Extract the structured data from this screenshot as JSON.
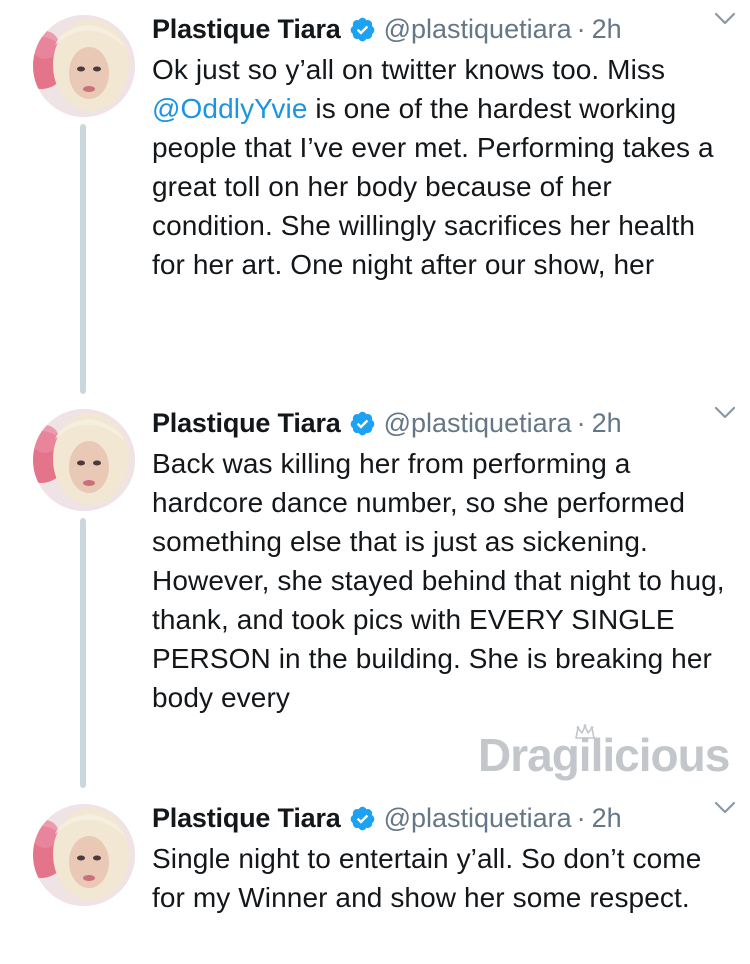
{
  "tweets": [
    {
      "display_name": "Plastique Tiara",
      "handle": "@plastiquetiara",
      "dot": "·",
      "timestamp": "2h",
      "text_before": "Ok just so y’all on twitter knows too. Miss ",
      "mention": "@OddlyYvie",
      "text_after": " is one of the hardest working people that I’ve ever met. Performing takes a great toll on her body because of her condition. She willingly sacrifices her health for her art. One night after our show, her"
    },
    {
      "display_name": "Plastique Tiara",
      "handle": "@plastiquetiara",
      "dot": "·",
      "timestamp": "2h",
      "text": "Back was killing her from performing a hardcore dance number, so she performed something else that is just as sickening. However, she stayed behind that night to hug, thank, and took pics with EVERY SINGLE PERSON in the building. She is breaking her body every"
    },
    {
      "display_name": "Plastique Tiara",
      "handle": "@plastiquetiara",
      "dot": "·",
      "timestamp": "2h",
      "text": "Single night to entertain y’all. So don’t come for my Winner and show her some respect."
    }
  ],
  "watermark": {
    "text": "Dragilicious",
    "color": "#b9bec4"
  },
  "icons": {
    "verified": "verified-badge-icon",
    "chevron": "chevron-down-icon"
  },
  "colors": {
    "name": "#14171a",
    "secondary": "#657786",
    "mention": "#1b95e0",
    "verified": "#1da1f2",
    "thread_line": "#ccd6dd"
  }
}
